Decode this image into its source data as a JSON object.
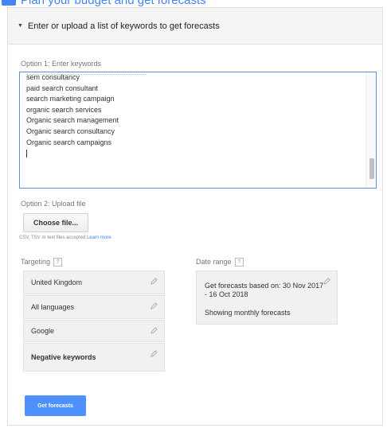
{
  "header": {
    "title": "Plan your budget and get forecasts"
  },
  "section": {
    "title": "Enter or upload a list of keywords to get forecasts"
  },
  "option1": {
    "label": "Option 1: Enter keywords",
    "keywords": [
      "sem consultancy",
      "paid search consultant",
      "search marketing campaign",
      "organic search services",
      "Organic search management",
      "Organic search consultancy",
      "Organic search campaigns"
    ]
  },
  "option2": {
    "label": "Option 2: Upload file",
    "choose_file": "Choose file...",
    "hint": "CSV, TSV or text files accepted",
    "learn_more": "Learn more"
  },
  "targeting": {
    "label": "Targeting",
    "help": "?",
    "items": [
      {
        "label": "United Kingdom"
      },
      {
        "label": "All languages"
      },
      {
        "label": "Google"
      },
      {
        "label": "Negative keywords"
      }
    ]
  },
  "date_range": {
    "label": "Date range",
    "help": "?",
    "line1": "Get forecasts based on: 30 Nov 2017 - 16 Oct 2018",
    "line2": "Showing monthly forecasts"
  },
  "actions": {
    "get_forecasts": "Get forecasts"
  }
}
